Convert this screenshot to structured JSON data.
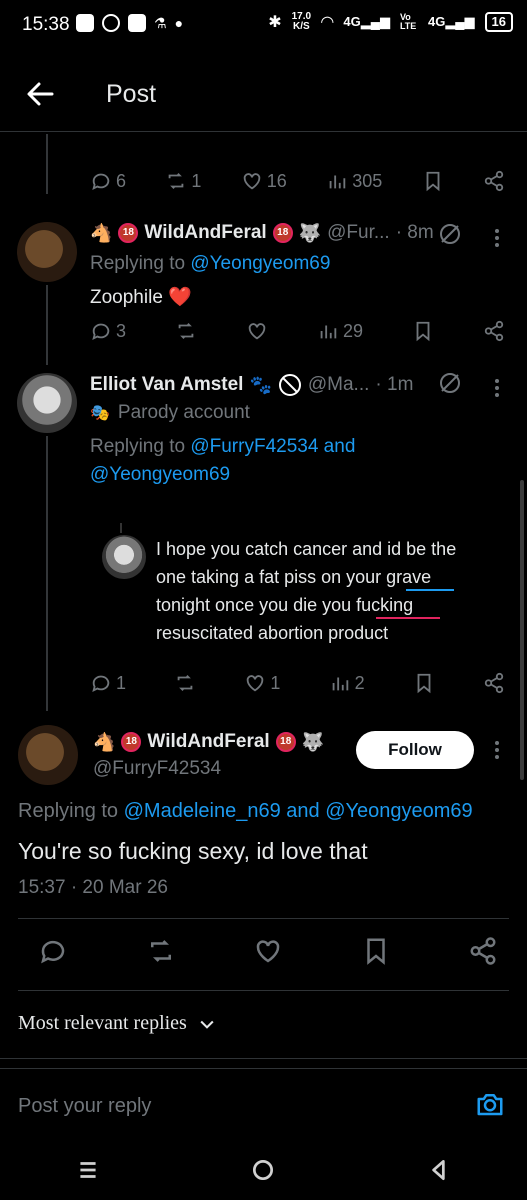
{
  "status_bar": {
    "time": "15:38",
    "speed_value": "17.0",
    "speed_unit": "K/S",
    "net1": "4G",
    "volte": "Vo LTE",
    "net2": "4G",
    "battery": "16"
  },
  "header": {
    "title": "Post"
  },
  "first_post_actions": {
    "replies": "6",
    "reposts": "1",
    "likes": "16",
    "views": "305"
  },
  "reply1": {
    "name": "WildAndFeral",
    "handle": "@Fur...",
    "time": "· 8m",
    "replying_prefix": "Replying to ",
    "replying_to": "@Yeongyeom69",
    "text": "Zoophile ❤️",
    "replies": "3",
    "reposts": "",
    "likes": "",
    "views": "29"
  },
  "reply2": {
    "name": "Elliot Van Amstel",
    "handle": "@Ma...",
    "time": "· 1m",
    "label": "Parody account",
    "replying_prefix": "Replying to ",
    "replying_to_1": "@FurryF42534",
    "and": " and",
    "replying_to_2": "@Yeongyeom69",
    "quote_lines": [
      "I hope you catch cancer and id be the",
      "one taking a fat piss on your grave",
      "tonight once you die you fucking",
      "resuscitated abortion product"
    ],
    "replies": "1",
    "reposts": "",
    "likes": "1",
    "views": "2"
  },
  "main_post": {
    "name": "WildAndFeral",
    "handle": "@FurryF42534",
    "follow_label": "Follow",
    "replying_prefix": "Replying to ",
    "replying_to_1": "@Madeleine_n69",
    "and": " and ",
    "replying_to_2": "@Yeongyeom69",
    "text": "You're so fucking sexy, id love that",
    "timestamp": "15:37 · 20 Mar 26"
  },
  "sort": {
    "label": "Most relevant replies"
  },
  "reply_box": {
    "placeholder": "Post your reply"
  },
  "colors": {
    "accent": "#1d9bf0",
    "muted": "#71767b",
    "background": "#000000",
    "heart": "#f91880"
  }
}
